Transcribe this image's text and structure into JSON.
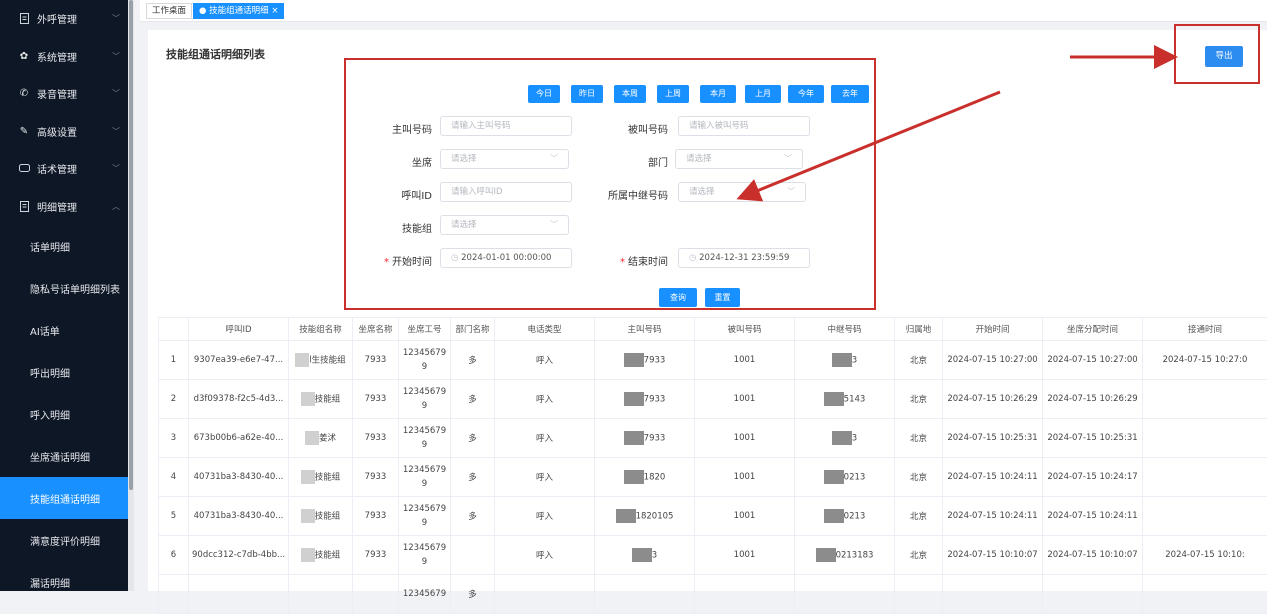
{
  "sidebar": {
    "menus": [
      {
        "label": "外呼管理",
        "icon": "document-icon"
      },
      {
        "label": "系统管理",
        "icon": "gear-icon"
      },
      {
        "label": "录音管理",
        "icon": "phone-icon"
      },
      {
        "label": "高级设置",
        "icon": "pen-icon"
      },
      {
        "label": "话术管理",
        "icon": "chat-icon"
      },
      {
        "label": "明细管理",
        "icon": "list-icon"
      }
    ],
    "subs": [
      "话单明细",
      "隐私号话单明细列表",
      "AI话单",
      "呼出明细",
      "呼入明细",
      "坐席通话明细",
      "技能组通话明细",
      "满意度评价明细",
      "漏话明细"
    ],
    "active_index": 6
  },
  "tabs": {
    "home": "工作桌面",
    "current": "技能组通话明细"
  },
  "page": {
    "title": "技能组通话明细列表",
    "export_label": "导出"
  },
  "quick": [
    "今日",
    "昨日",
    "本周",
    "上周",
    "本月",
    "上月",
    "今年",
    "去年"
  ],
  "form": {
    "caller_label": "主叫号码",
    "caller_ph": "请输入主叫号码",
    "callee_label": "被叫号码",
    "callee_ph": "请输入被叫号码",
    "agent_label": "坐席",
    "agent_ph": "请选择",
    "dept_label": "部门",
    "dept_ph": "请选择",
    "callid_label": "呼叫ID",
    "callid_ph": "请输入呼叫ID",
    "trunk_label": "所属中继号码",
    "trunk_ph": "请选择",
    "skill_label": "技能组",
    "skill_ph": "请选择",
    "start_label": "开始时间",
    "start_val": "2024-01-01 00:00:00",
    "end_label": "结束时间",
    "end_val": "2024-12-31 23:59:59",
    "query": "查询",
    "reset": "重置"
  },
  "table": {
    "headers": [
      "",
      "呼叫ID",
      "技能组名称",
      "坐席名称",
      "坐席工号",
      "部门名称",
      "电话类型",
      "主叫号码",
      "被叫号码",
      "中继号码",
      "归属地",
      "开始时间",
      "坐席分配时间",
      "接通时间"
    ],
    "rows": [
      {
        "n": "1",
        "id": "9307ea39-e6e7-47...",
        "skill": "l生技能组",
        "agent": "7933",
        "no": "12345679 9",
        "dept": "多",
        "type": "呼入",
        "caller": "7933",
        "callee": "1001",
        "trunk": "3",
        "loc": "北京",
        "start": "2024-07-15 10:27:00",
        "assign": "2024-07-15 10:27:00",
        "conn": "2024-07-15 10:27:0"
      },
      {
        "n": "2",
        "id": "d3f09378-f2c5-4d3...",
        "skill": "技能组",
        "agent": "7933",
        "no": "12345679 9",
        "dept": "多",
        "type": "呼入",
        "caller": "7933",
        "callee": "1001",
        "trunk": "5143",
        "loc": "北京",
        "start": "2024-07-15 10:26:29",
        "assign": "2024-07-15 10:26:29",
        "conn": ""
      },
      {
        "n": "3",
        "id": "673b00b6-a62e-40...",
        "skill": "姜沭",
        "agent": "7933",
        "no": "12345679 9",
        "dept": "多",
        "type": "呼入",
        "caller": "7933",
        "callee": "1001",
        "trunk": "3",
        "loc": "北京",
        "start": "2024-07-15 10:25:31",
        "assign": "2024-07-15 10:25:31",
        "conn": ""
      },
      {
        "n": "4",
        "id": "40731ba3-8430-40...",
        "skill": "技能组",
        "agent": "7933",
        "no": "12345679 9",
        "dept": "多",
        "type": "呼入",
        "caller": "1820",
        "callee": "1001",
        "trunk": "0213",
        "loc": "北京",
        "start": "2024-07-15 10:24:11",
        "assign": "2024-07-15 10:24:17",
        "conn": ""
      },
      {
        "n": "5",
        "id": "40731ba3-8430-40...",
        "skill": "技能组",
        "agent": "7933",
        "no": "12345679 9",
        "dept": "多",
        "type": "呼入",
        "caller": "1820105",
        "callee": "1001",
        "trunk": "0213",
        "loc": "北京",
        "start": "2024-07-15 10:24:11",
        "assign": "2024-07-15 10:24:11",
        "conn": ""
      },
      {
        "n": "6",
        "id": "90dcc312-c7db-4bb...",
        "skill": "技能组",
        "agent": "7933",
        "no": "12345679 9",
        "dept": "",
        "type": "呼入",
        "caller": "3",
        "callee": "1001",
        "trunk": "0213183",
        "loc": "北京",
        "start": "2024-07-15 10:10:07",
        "assign": "2024-07-15 10:10:07",
        "conn": "2024-07-15 10:10:"
      },
      {
        "n": "",
        "id": "",
        "skill": "",
        "agent": "",
        "no": "12345679",
        "dept": "多",
        "type": "",
        "caller": "",
        "callee": "",
        "trunk": "",
        "loc": "",
        "start": "",
        "assign": "",
        "conn": ""
      }
    ]
  },
  "colors": {
    "primary": "#1890ff",
    "sidebar": "#0e1726",
    "annotation": "#c9302c"
  }
}
